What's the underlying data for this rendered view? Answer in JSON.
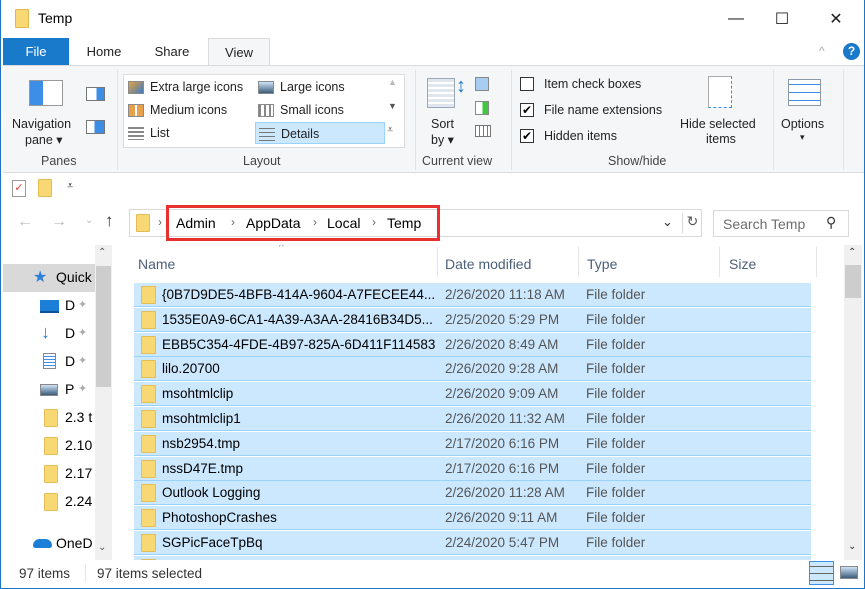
{
  "window": {
    "title": "Temp",
    "minimize_glyph": "—",
    "maximize_glyph": "☐",
    "close_glyph": "✕"
  },
  "tabs": [
    {
      "label": "File"
    },
    {
      "label": "Home"
    },
    {
      "label": "Share"
    },
    {
      "label": "View",
      "active": true
    }
  ],
  "ribbon": {
    "collapse_glyph": "^",
    "help_glyph": "?",
    "panes": {
      "group_label": "Panes",
      "navigation_pane": "Navigation",
      "navigation_pane_2": "pane ▾"
    },
    "layout": {
      "group_label": "Layout",
      "items": [
        {
          "label": "Extra large icons"
        },
        {
          "label": "Large icons"
        },
        {
          "label": "Medium icons"
        },
        {
          "label": "Small icons"
        },
        {
          "label": "List"
        },
        {
          "label": "Details",
          "selected": true
        }
      ]
    },
    "current_view": {
      "group_label": "Current view",
      "sort_by_1": "Sort",
      "sort_by_2": "by ▾"
    },
    "show_hide": {
      "group_label": "Show/hide",
      "checkboxes": [
        {
          "label": "Item check boxes",
          "checked": false
        },
        {
          "label": "File name extensions",
          "checked": true
        },
        {
          "label": "Hidden items",
          "checked": true
        }
      ],
      "hide_selected_1": "Hide selected",
      "hide_selected_2": "items"
    },
    "options": {
      "label": "Options",
      "arrow": "▾"
    }
  },
  "address": {
    "breadcrumb": [
      "Admin",
      "AppData",
      "Local",
      "Temp"
    ],
    "separator": "›",
    "search_placeholder": "Search Temp"
  },
  "nav_pane": {
    "items": [
      {
        "label": "Quick",
        "icon": "quick-access-star-icon"
      },
      {
        "label": "D",
        "icon": "desktop-icon",
        "pinned": true
      },
      {
        "label": "D",
        "icon": "downloads-icon",
        "pinned": true
      },
      {
        "label": "D",
        "icon": "documents-icon",
        "pinned": true
      },
      {
        "label": "P",
        "icon": "pictures-icon",
        "pinned": true
      },
      {
        "label": "2.3 t",
        "icon": "folder-icon"
      },
      {
        "label": "2.10",
        "icon": "folder-icon"
      },
      {
        "label": "2.17",
        "icon": "folder-icon"
      },
      {
        "label": "2.24",
        "icon": "folder-icon"
      },
      {
        "label": "OneD",
        "icon": "onedrive-cloud-icon"
      }
    ]
  },
  "file_list": {
    "columns": [
      "Name",
      "Date modified",
      "Type",
      "Size"
    ],
    "rows": [
      {
        "name": "{0B7D9DE5-4BFB-414A-9604-A7FECEE44...",
        "date": "2/26/2020 11:18 AM",
        "type": "File folder"
      },
      {
        "name": "1535E0A9-6CA1-4A39-A3AA-28416B34D5...",
        "date": "2/25/2020 5:29 PM",
        "type": "File folder"
      },
      {
        "name": "EBB5C354-4FDE-4B97-825A-6D411F114583",
        "date": "2/26/2020 8:49 AM",
        "type": "File folder"
      },
      {
        "name": "lilo.20700",
        "date": "2/26/2020 9:28 AM",
        "type": "File folder"
      },
      {
        "name": "msohtmlclip",
        "date": "2/26/2020 9:09 AM",
        "type": "File folder"
      },
      {
        "name": "msohtmlclip1",
        "date": "2/26/2020 11:32 AM",
        "type": "File folder"
      },
      {
        "name": "nsb2954.tmp",
        "date": "2/17/2020 6:16 PM",
        "type": "File folder"
      },
      {
        "name": "nssD47E.tmp",
        "date": "2/17/2020 6:16 PM",
        "type": "File folder"
      },
      {
        "name": "Outlook Logging",
        "date": "2/26/2020 11:28 AM",
        "type": "File folder"
      },
      {
        "name": "PhotoshopCrashes",
        "date": "2/26/2020 9:11 AM",
        "type": "File folder"
      },
      {
        "name": "SGPicFaceTpBq",
        "date": "2/24/2020 5:47 PM",
        "type": "File folder"
      }
    ]
  },
  "status_bar": {
    "item_count": "97 items",
    "selected_count": "97 items selected"
  },
  "colors": {
    "accent": "#1979ca",
    "selection": "#cce8ff",
    "selection_border": "#99d1ff",
    "highlight_box": "#e8302f",
    "folder": "#f8d775"
  }
}
